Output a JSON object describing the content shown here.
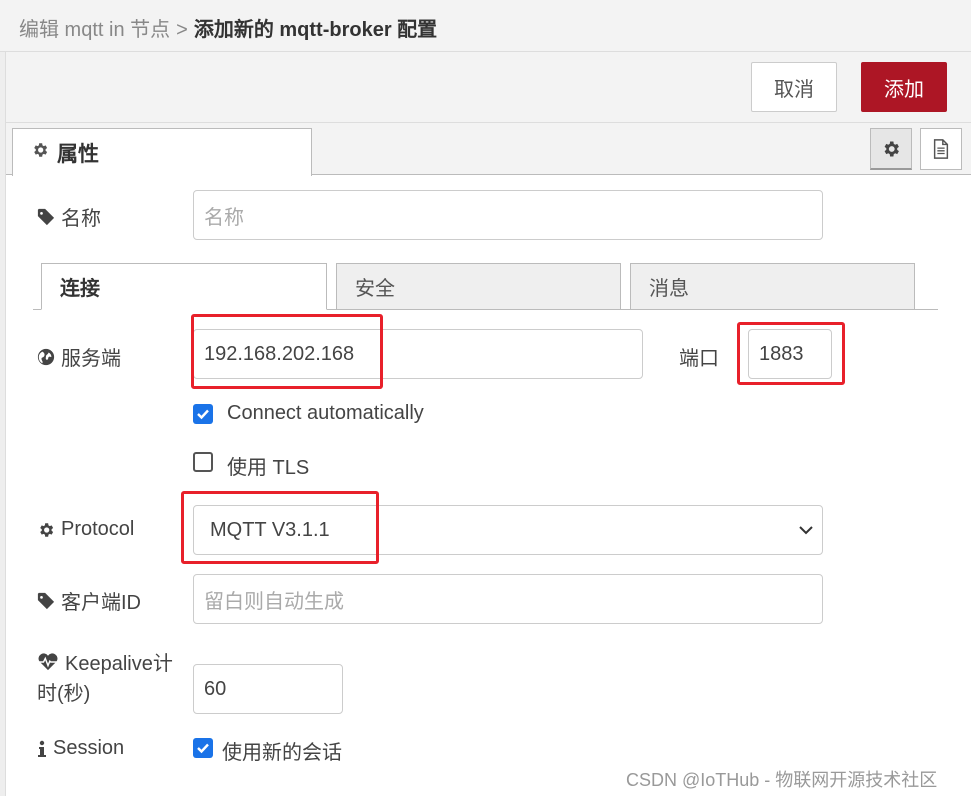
{
  "breadcrumb": {
    "parent": "编辑 mqtt in 节点",
    "separator": ">",
    "current": "添加新的 mqtt-broker 配置"
  },
  "toolbar": {
    "cancel_label": "取消",
    "add_label": "添加",
    "add_color": "#ad1625"
  },
  "tabs": {
    "properties_label": "属性"
  },
  "form": {
    "name": {
      "label": "名称",
      "placeholder": "名称",
      "value": ""
    },
    "subtabs": [
      {
        "label": "连接",
        "active": true
      },
      {
        "label": "安全",
        "active": false
      },
      {
        "label": "消息",
        "active": false
      }
    ],
    "server": {
      "label": "服务端",
      "value": "192.168.202.168"
    },
    "port": {
      "label": "端口",
      "value": "1883"
    },
    "connect_auto": {
      "label": "Connect automatically",
      "checked": true
    },
    "use_tls": {
      "label": "使用 TLS",
      "checked": false
    },
    "protocol": {
      "label": "Protocol",
      "value": "MQTT V3.1.1"
    },
    "client_id": {
      "label": "客户端ID",
      "placeholder": "留白则自动生成",
      "value": ""
    },
    "keepalive": {
      "label_line1": "Keepalive计",
      "label_line2": "时(秒)",
      "value": "60"
    },
    "session": {
      "label": "Session",
      "checkbox_label": "使用新的会话",
      "checked": true
    }
  },
  "watermark": "CSDN @IoTHub - 物联网开源技术社区",
  "highlight_color": "#e8202a"
}
